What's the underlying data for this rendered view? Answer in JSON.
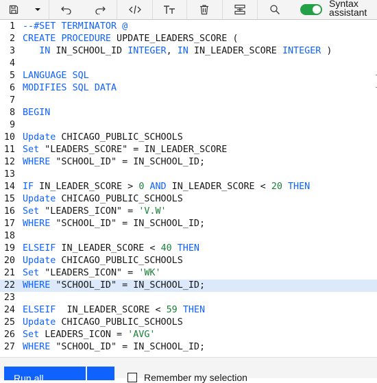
{
  "toolbar": {
    "icons": [
      "save-icon",
      "dropdown-caret-icon",
      "undo-icon",
      "redo-icon",
      "code-icon",
      "format-text-icon",
      "delete-icon",
      "layout-icon",
      "search-icon"
    ],
    "syntax_assistant_label": "Syntax assistant",
    "syntax_assistant_on": true,
    "accent_color": "#24a148"
  },
  "editor": {
    "active_line": 22,
    "lines": [
      {
        "n": "1",
        "t": "--#SET TERMINATOR @"
      },
      {
        "n": "2",
        "t": "CREATE PROCEDURE UPDATE_LEADERS_SCORE ("
      },
      {
        "n": "3",
        "t": "   IN IN_SCHOOL_ID INTEGER, IN IN_LEADER_SCORE INTEGER )"
      },
      {
        "n": "4",
        "t": ""
      },
      {
        "n": "5",
        "t": "LANGUAGE SQL"
      },
      {
        "n": "6",
        "t": "MODIFIES SQL DATA"
      },
      {
        "n": "7",
        "t": ""
      },
      {
        "n": "8",
        "t": "BEGIN"
      },
      {
        "n": "9",
        "t": ""
      },
      {
        "n": "10",
        "t": "Update CHICAGO_PUBLIC_SCHOOLS"
      },
      {
        "n": "11",
        "t": "Set \"LEADERS_SCORE\" = IN_LEADER_SCORE"
      },
      {
        "n": "12",
        "t": "WHERE \"SCHOOL_ID\" = IN_SCHOOL_ID;"
      },
      {
        "n": "13",
        "t": ""
      },
      {
        "n": "14",
        "t": "IF IN_LEADER_SCORE > 0 AND IN_LEADER_SCORE < 20 THEN"
      },
      {
        "n": "15",
        "t": "Update CHICAGO_PUBLIC_SCHOOLS"
      },
      {
        "n": "16",
        "t": "Set \"LEADERS_ICON\" = 'V.W'"
      },
      {
        "n": "17",
        "t": "WHERE \"SCHOOL_ID\" = IN_SCHOOL_ID;"
      },
      {
        "n": "18",
        "t": ""
      },
      {
        "n": "19",
        "t": "ELSEIF IN_LEADER_SCORE < 40 THEN"
      },
      {
        "n": "20",
        "t": "Update CHICAGO_PUBLIC_SCHOOLS"
      },
      {
        "n": "21",
        "t": "Set \"LEADERS_ICON\" = 'WK'"
      },
      {
        "n": "22",
        "t": "WHERE \"SCHOOL_ID\" = IN_SCHOOL_ID;"
      },
      {
        "n": "23",
        "t": ""
      },
      {
        "n": "24",
        "t": "ELSEIF  IN_LEADER_SCORE < 59 THEN"
      },
      {
        "n": "25",
        "t": "Update CHICAGO_PUBLIC_SCHOOLS"
      },
      {
        "n": "26",
        "t": "Set LEADERS_ICON = 'AVG'"
      },
      {
        "n": "27",
        "t": "WHERE \"SCHOOL_ID\" = IN_SCHOOL_ID;"
      }
    ]
  },
  "footer": {
    "run_button_label": "Run all",
    "remember_label": "Remember my selection",
    "remember_checked": false,
    "button_color": "#0f62fe"
  }
}
